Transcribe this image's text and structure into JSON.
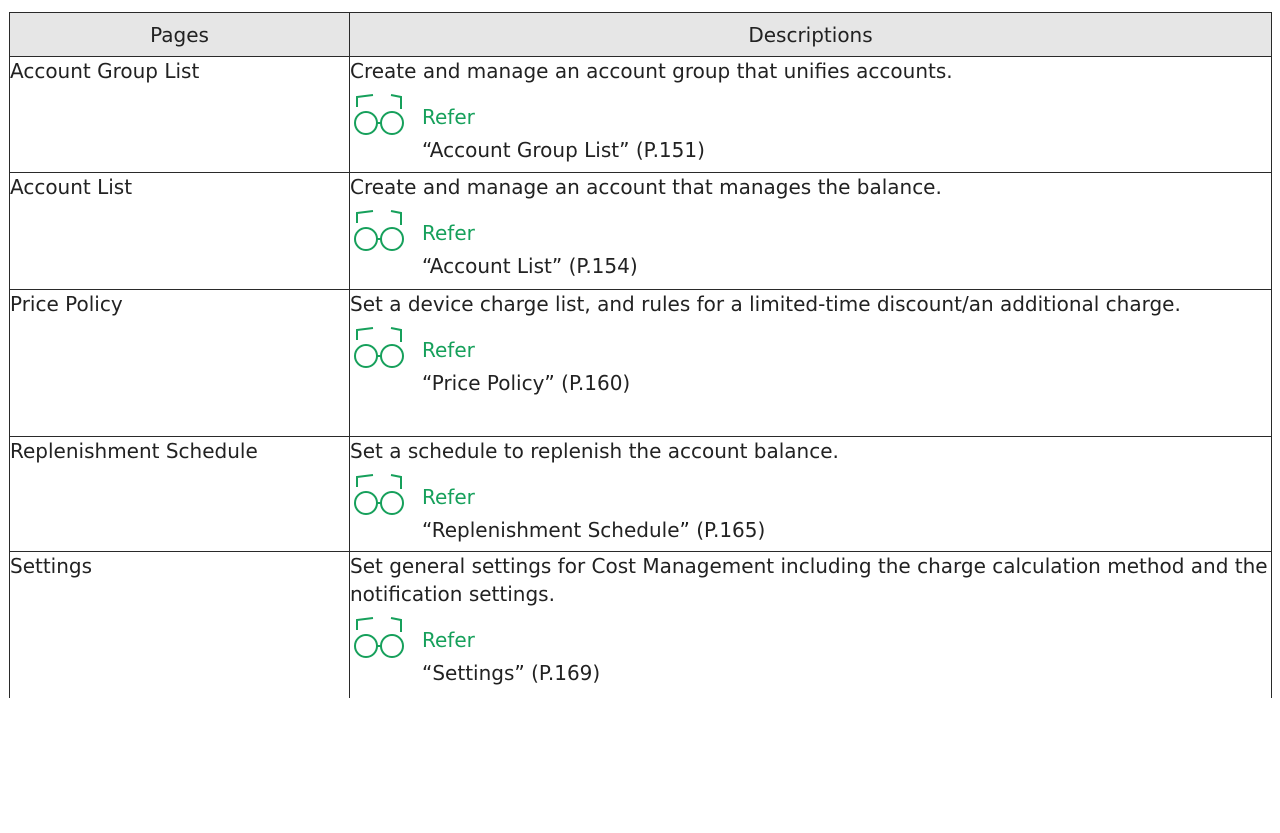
{
  "table": {
    "headers": {
      "pages": "Pages",
      "descriptions": "Descriptions"
    },
    "refer_label": "Refer",
    "rows": [
      {
        "page": "Account Group List",
        "description": "Create and manage an account group that unifies accounts.",
        "reference": "“Account Group List” (P.151)"
      },
      {
        "page": "Account List",
        "description": "Create and manage an account that manages the balance.",
        "reference": "“Account List” (P.154)"
      },
      {
        "page": "Price Policy",
        "description": "Set a device charge list, and rules for a limited-time discount/an additional charge.",
        "reference": "“Price Policy” (P.160)"
      },
      {
        "page": "Replenishment Schedule",
        "description": "Set a schedule to replenish the account balance.",
        "reference": "“Replenishment Schedule” (P.165)"
      },
      {
        "page": "Settings",
        "description": "Set general settings for Cost Management including the charge calculation method and the notification settings.",
        "reference": "“Settings” (P.169)"
      }
    ]
  },
  "colors": {
    "refer": "#16a05b",
    "header_bg": "#e6e6e6",
    "border": "#2a2a2a"
  },
  "icons": {
    "refer": "glasses-icon"
  }
}
